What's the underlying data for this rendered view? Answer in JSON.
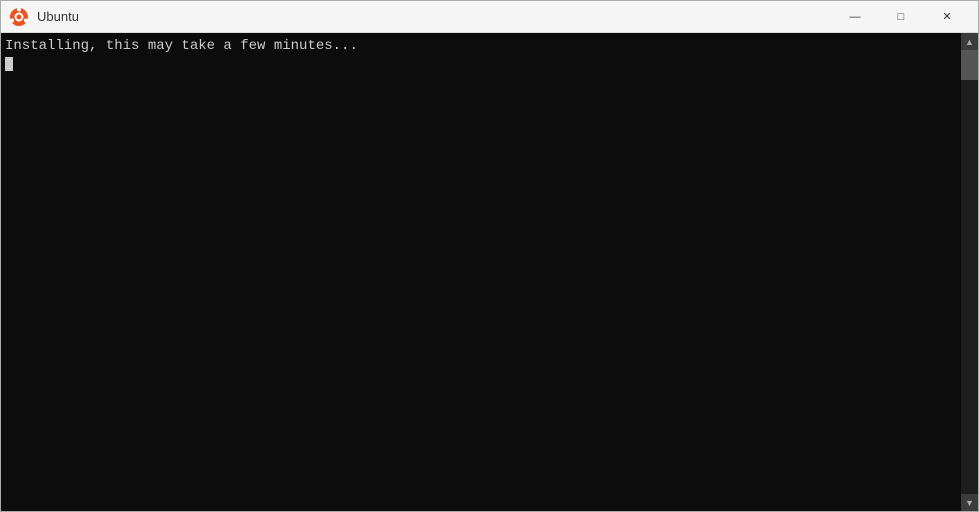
{
  "window": {
    "title": "Ubuntu",
    "icon": "ubuntu-icon"
  },
  "titlebar": {
    "controls": {
      "minimize_label": "—",
      "maximize_label": "□",
      "close_label": "✕"
    }
  },
  "terminal": {
    "line1": "Installing, this may take a few minutes...",
    "line2": ""
  }
}
